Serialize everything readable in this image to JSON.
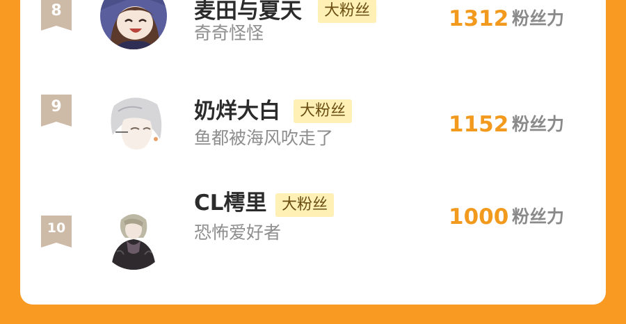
{
  "colors": {
    "page_background": "#F99A22",
    "card_background": "#FFFFFF",
    "rank_ribbon": "#CDBAA7",
    "badge_background": "#FFF0B5",
    "score_text": "#F29A1E"
  },
  "leaderboard": {
    "rows": [
      {
        "rank": "8",
        "name": "麦田与夏天",
        "badge": "大粉丝",
        "signature": "奇奇怪怪",
        "score": "1312",
        "score_unit": "粉丝力",
        "avatar_icon": "anime-girl-witch-hat-avatar"
      },
      {
        "rank": "9",
        "name": "奶烊大白",
        "badge": "大粉丝",
        "signature": "鱼都被海风吹走了",
        "score": "1152",
        "score_unit": "粉丝力",
        "avatar_icon": "anime-white-hair-boy-avatar"
      },
      {
        "rank": "10",
        "name": "CL樗里",
        "badge": "大粉丝",
        "signature": "恐怖爱好者",
        "score": "1000",
        "score_unit": "粉丝力",
        "avatar_icon": "anime-dark-coat-man-avatar"
      }
    ]
  }
}
